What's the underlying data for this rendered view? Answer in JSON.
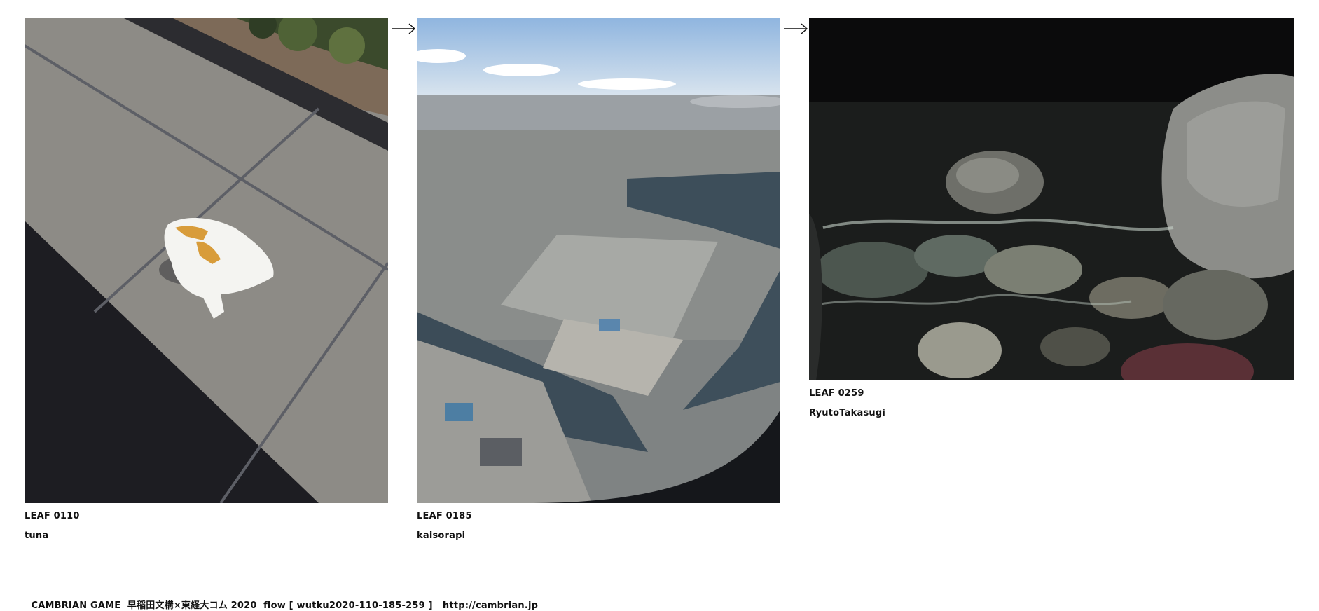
{
  "leaves": [
    {
      "id": "LEAF 0110",
      "author": "tuna",
      "image": "plastic-bag-on-pavement-photo"
    },
    {
      "id": "LEAF 0185",
      "author": "kaisorapi",
      "image": "aerial-harbor-city-photo"
    },
    {
      "id": "LEAF 0259",
      "author": "RyutoTakasugi",
      "image": "night-rocks-shore-photo"
    }
  ],
  "arrows": [
    "arrow-right-icon",
    "arrow-right-icon"
  ],
  "footer": {
    "text": "CAMBRIAN GAME  早稲田文構×東経大コム 2020  flow [ wutku2020-110-185-259 ]   ",
    "link": "http://cambrian.jp"
  }
}
